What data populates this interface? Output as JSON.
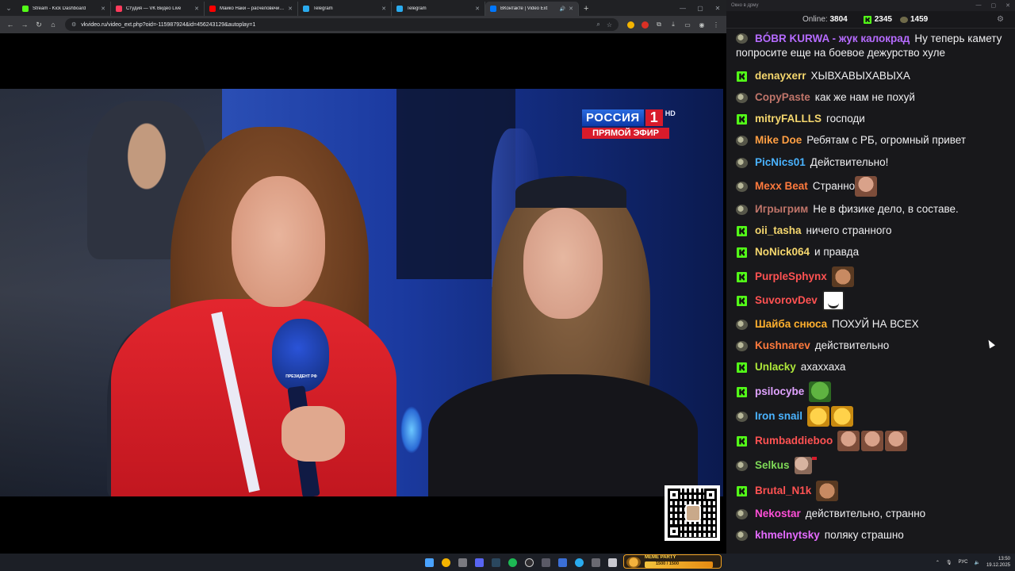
{
  "browser": {
    "tabs": [
      {
        "label": "Stream - Kick Dashboard",
        "fav_color": "#53fc18"
      },
      {
        "label": "Студия — VK Видео Live",
        "fav_color": "#ff3b5c"
      },
      {
        "label": "Майко Наки – расчеловечива...",
        "fav_color": "#ff0000"
      },
      {
        "label": "Telegram",
        "fav_color": "#2aabee"
      },
      {
        "label": "Telegram",
        "fav_color": "#2aabee"
      },
      {
        "label": "ВКонтакте | Video Ext",
        "fav_color": "#0077ff"
      }
    ],
    "url": "vkvideo.ru/video_ext.php?oid=-115987924&id=456243129&autoplay=1"
  },
  "video": {
    "channel_name": "РОССИЯ",
    "channel_number": "1",
    "channel_hd": "HD",
    "live_label": "ПРЯМОЙ ЭФИР",
    "mic_label": "ПРЕЗИДЕНТ РФ"
  },
  "chat": {
    "window_title": "Окно в дрму",
    "online_label": "Online:",
    "online_count": "3804",
    "kick_count": "2345",
    "vk_count": "1459",
    "messages": [
      {
        "badge": "g",
        "user": "BÓBR KURWA - жук калокрад",
        "color": "#b66bff",
        "text": "Ну теперь камету попросите еще на боевое дежурство хуле",
        "emotes": []
      },
      {
        "badge": "k",
        "user": "denayxerr",
        "color": "#f5d76e",
        "text": "ХЫВХАВЫХАВЫХА",
        "emotes": []
      },
      {
        "badge": "g",
        "user": "CopyPaste",
        "color": "#c0756a",
        "text": "как же нам не похуй",
        "emotes": []
      },
      {
        "badge": "k",
        "user": "mitryFALLLS",
        "color": "#f5d76e",
        "text": "господи",
        "emotes": []
      },
      {
        "badge": "g",
        "user": "Mike Doe",
        "color": "#ff9f43",
        "text": "Ребятам с РБ, огромный привет",
        "emotes": []
      },
      {
        "badge": "g",
        "user": "PicNics01",
        "color": "#4ab3ff",
        "text": "Действительно!",
        "emotes": []
      },
      {
        "badge": "g",
        "user": "Mexx Beat",
        "color": "#ff7a3d",
        "text": "Странно",
        "emotes": [
          "face"
        ]
      },
      {
        "badge": "g",
        "user": "Игрыгрим",
        "color": "#c0756a",
        "text": "Не в физике дело, в составе.",
        "emotes": []
      },
      {
        "badge": "k",
        "user": "oii_tasha",
        "color": "#f5d76e",
        "text": "ничего странного",
        "emotes": []
      },
      {
        "badge": "k",
        "user": "NoNick064",
        "color": "#f5d76e",
        "text": "и правда",
        "emotes": []
      },
      {
        "badge": "k",
        "user": "PurpleSphynx",
        "color": "#ff5252",
        "text": "",
        "emotes": [
          "grin"
        ]
      },
      {
        "badge": "k",
        "user": "SuvorovDev",
        "color": "#ff5252",
        "text": "",
        "emotes": [
          "troll"
        ]
      },
      {
        "badge": "g",
        "user": "Шайба снюса",
        "color": "#ffb02e",
        "text": "ПОХУЙ НА ВСЕХ",
        "emotes": []
      },
      {
        "badge": "g",
        "user": "Kushnarev",
        "color": "#ff7a3d",
        "text": "действительно",
        "emotes": []
      },
      {
        "badge": "k",
        "user": "Unlacky",
        "color": "#aee83a",
        "text": "ахаххаха",
        "emotes": []
      },
      {
        "badge": "k",
        "user": "psilocybe",
        "color": "#e0a3ff",
        "text": "",
        "emotes": [
          "pepe"
        ]
      },
      {
        "badge": "g",
        "user": "Iron snail",
        "color": "#4ab3ff",
        "text": "",
        "emotes": [
          "laugh",
          "laugh"
        ]
      },
      {
        "badge": "k",
        "user": "Rumbaddieboo",
        "color": "#ff5252",
        "text": "",
        "emotes": [
          "face",
          "face",
          "face"
        ]
      },
      {
        "badge": "g",
        "user": "Selkus",
        "color": "#7ed957",
        "text": "",
        "emotes": [
          "small"
        ]
      },
      {
        "badge": "k",
        "user": "Brutal_N1k",
        "color": "#ff5252",
        "text": "",
        "emotes": [
          "grin"
        ]
      },
      {
        "badge": "g",
        "user": "Nekostar",
        "color": "#ff4fd8",
        "text": "действительно, странно",
        "emotes": []
      },
      {
        "badge": "g",
        "user": "khmelnytsky",
        "color": "#e56bff",
        "text": "поляку страшно",
        "emotes": []
      }
    ]
  },
  "taskbar": {
    "widget_title": "MEME PARTY",
    "widget_value": "1500 / 1500",
    "lang": "РУС",
    "time": "13:50",
    "date": "19.12.2025"
  }
}
